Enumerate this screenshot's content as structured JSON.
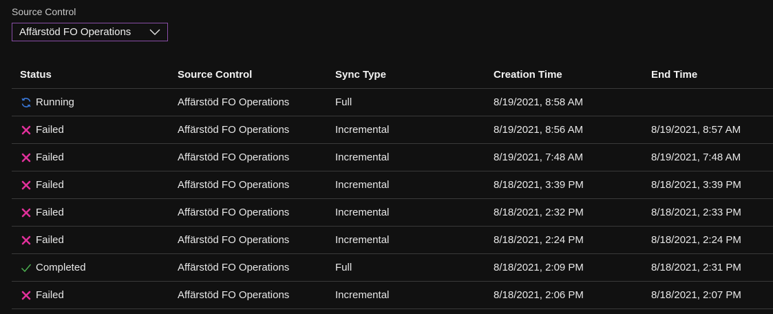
{
  "filter": {
    "label": "Source Control",
    "selected": "Affärstöd FO Operations"
  },
  "table": {
    "columns": [
      "Status",
      "Source Control",
      "Sync Type",
      "Creation Time",
      "End Time"
    ],
    "rows": [
      {
        "status": "Running",
        "status_icon": "sync-running-icon",
        "source": "Affärstöd FO Operations",
        "sync": "Full",
        "created": "8/19/2021, 8:58 AM",
        "end": ""
      },
      {
        "status": "Failed",
        "status_icon": "failed-x-icon",
        "source": "Affärstöd FO Operations",
        "sync": "Incremental",
        "created": "8/19/2021, 8:56 AM",
        "end": "8/19/2021, 8:57 AM"
      },
      {
        "status": "Failed",
        "status_icon": "failed-x-icon",
        "source": "Affärstöd FO Operations",
        "sync": "Incremental",
        "created": "8/19/2021, 7:48 AM",
        "end": "8/19/2021, 7:48 AM"
      },
      {
        "status": "Failed",
        "status_icon": "failed-x-icon",
        "source": "Affärstöd FO Operations",
        "sync": "Incremental",
        "created": "8/18/2021, 3:39 PM",
        "end": "8/18/2021, 3:39 PM"
      },
      {
        "status": "Failed",
        "status_icon": "failed-x-icon",
        "source": "Affärstöd FO Operations",
        "sync": "Incremental",
        "created": "8/18/2021, 2:32 PM",
        "end": "8/18/2021, 2:33 PM"
      },
      {
        "status": "Failed",
        "status_icon": "failed-x-icon",
        "source": "Affärstöd FO Operations",
        "sync": "Incremental",
        "created": "8/18/2021, 2:24 PM",
        "end": "8/18/2021, 2:24 PM"
      },
      {
        "status": "Completed",
        "status_icon": "completed-check-icon",
        "source": "Affärstöd FO Operations",
        "sync": "Full",
        "created": "8/18/2021, 2:09 PM",
        "end": "8/18/2021, 2:31 PM"
      },
      {
        "status": "Failed",
        "status_icon": "failed-x-icon",
        "source": "Affärstöd FO Operations",
        "sync": "Incremental",
        "created": "8/18/2021, 2:06 PM",
        "end": "8/18/2021, 2:07 PM"
      }
    ]
  },
  "colors": {
    "background": "#111111",
    "dropdown_border": "#8a4ea8",
    "failed": "#e0309a",
    "completed": "#4caf50",
    "running": "#3a78d8"
  }
}
